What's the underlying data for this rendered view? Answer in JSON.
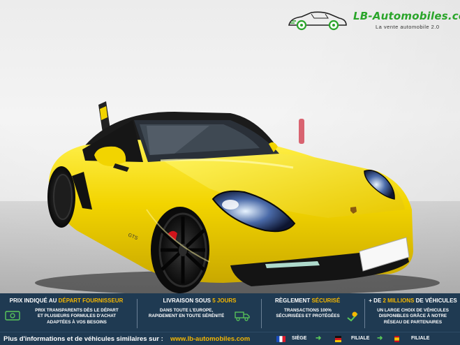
{
  "logo": {
    "brand": "LB-Automobiles.com",
    "tagline": "La vente automobile 2.0",
    "icon": "car-outline-icon"
  },
  "photo": {
    "subject": "car-photo",
    "badge_text": "GTS",
    "colors": {
      "body": "#f2d400",
      "roof": "#1c1c1c",
      "wheels": "#151515",
      "calipers": "#d0141b"
    }
  },
  "banner": {
    "columns": [
      {
        "head_prefix": "PRIX INDIQUÉ AU ",
        "head_highlight": "DÉPART FOURNISSEUR",
        "head_suffix": "",
        "lines": [
          "PRIX TRANSPARENTS DÈS LE DÉPART",
          "ET PLUSIEURS FORMULES D'ACHAT",
          "ADAPTÉES À VOS BESOINS"
        ],
        "icon": "money-icon"
      },
      {
        "head_prefix": "LIVRAISON SOUS ",
        "head_highlight": "5 JOURS",
        "head_suffix": "",
        "lines": [
          "DANS TOUTE L'EUROPE,",
          "RAPIDEMENT EN TOUTE SÉRÉNITÉ"
        ],
        "icon": "delivery-truck-icon"
      },
      {
        "head_prefix": "RÈGLEMENT ",
        "head_highlight": "SÉCURISÉ",
        "head_suffix": "",
        "lines": [
          "TRANSACTIONS 100%",
          "SÉCURISÉES ET PROTÉGÉES"
        ],
        "icon": "secure-payment-icon"
      },
      {
        "head_prefix": "+ DE ",
        "head_highlight": "2 MILLIONS",
        "head_suffix": " DE VÉHICULES",
        "lines": [
          "UN LARGE CHOIX DE VÉHICULES",
          "DISPONIBLES GRÂCE À NOTRE",
          "RÉSEAU DE PARTENAIRES"
        ],
        "icon": ""
      }
    ],
    "colors": {
      "background": "#1f3a52",
      "highlight": "#f5b700"
    }
  },
  "footer": {
    "text": "Plus d'informations et de véhicules similaires sur : ",
    "link": "www.lb-automobiles.com",
    "locations": [
      {
        "flag": "france-flag-icon",
        "label": "SIÈGE"
      },
      {
        "flag": "germany-flag-icon",
        "label": "FILIALE"
      },
      {
        "flag": "spain-flag-icon",
        "label": "FILIALE"
      }
    ]
  }
}
